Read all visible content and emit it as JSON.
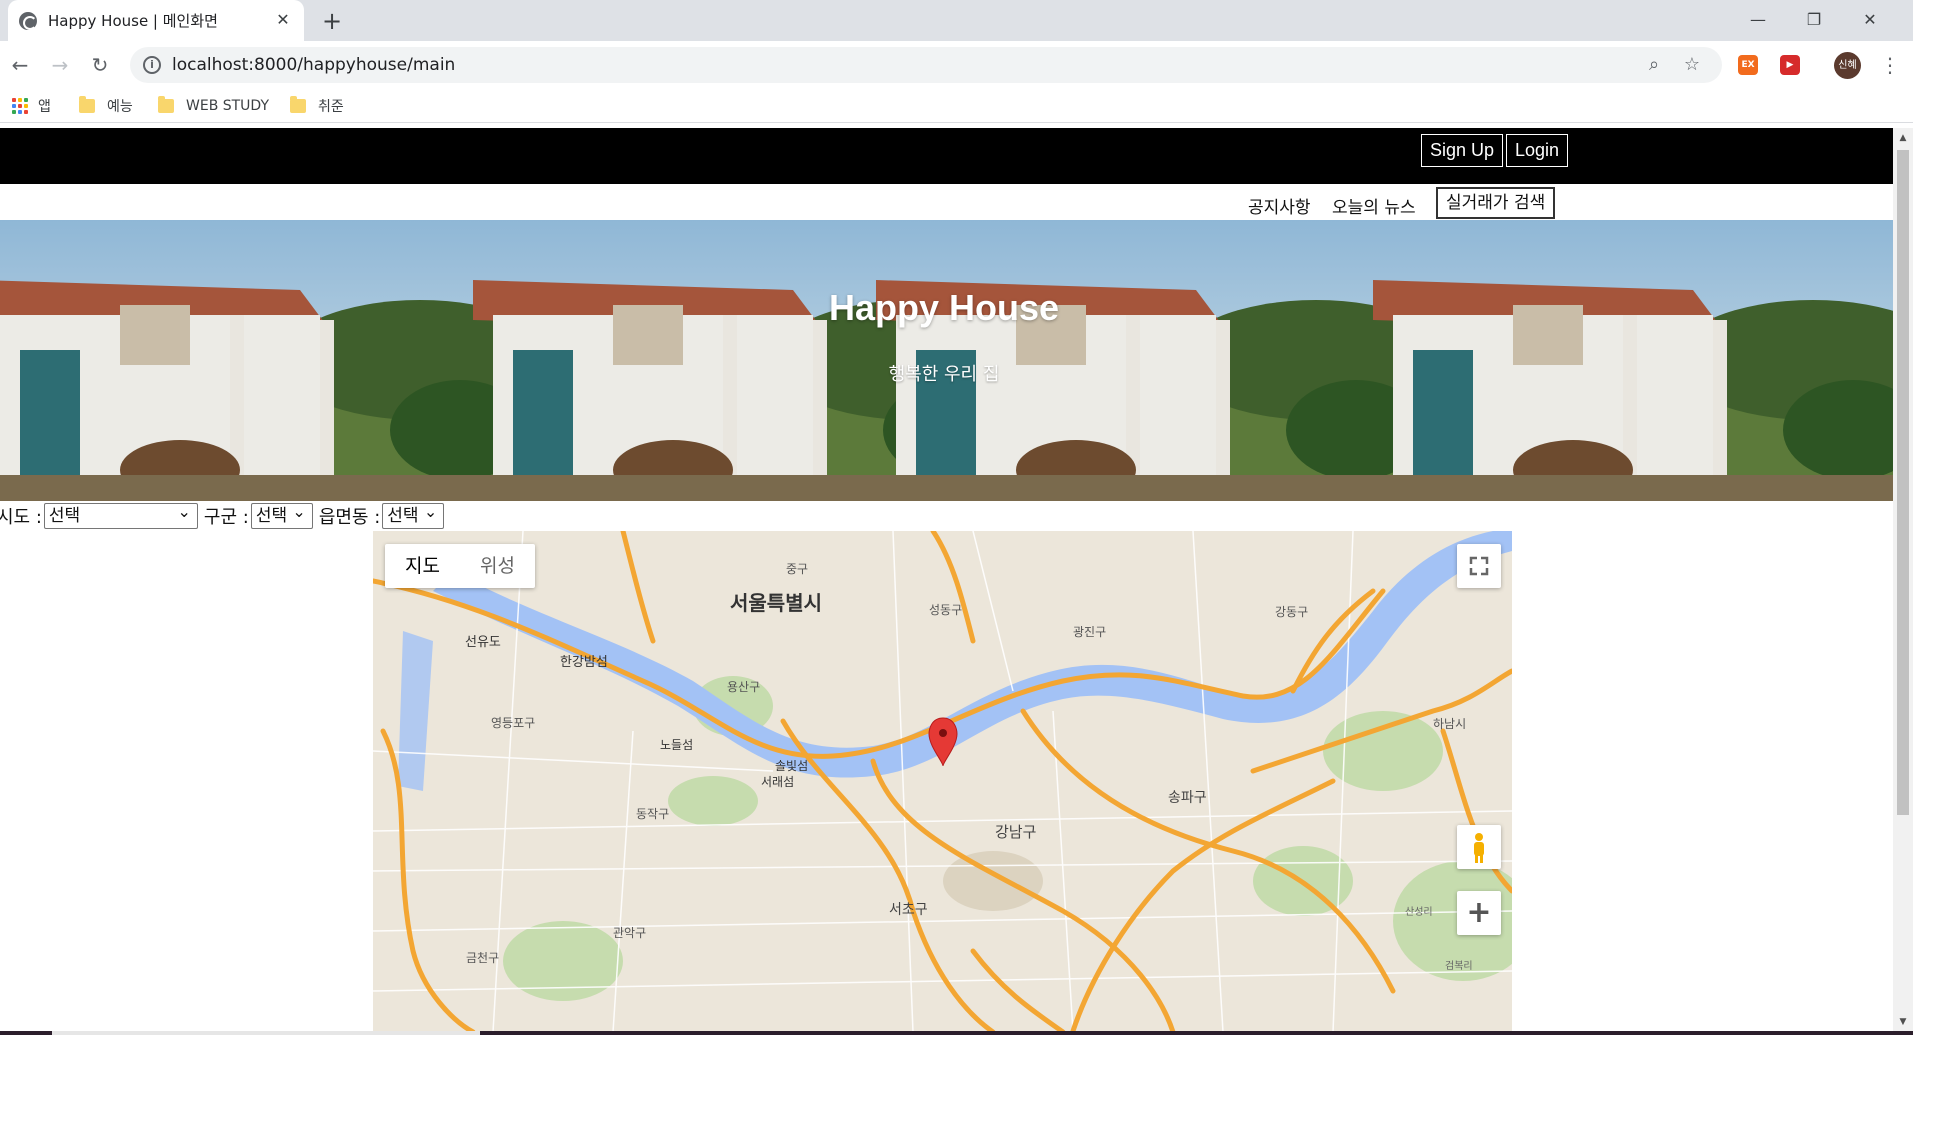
{
  "browser": {
    "tab_title": "Happy House | 메인화면",
    "url": "localhost:8000/happyhouse/main",
    "profile_initials": "신혜",
    "bookmarks": [
      "앱",
      "예능",
      "WEB STUDY",
      "취준"
    ],
    "extensions": [
      "EX",
      "▶"
    ]
  },
  "header": {
    "signup_label": "Sign Up",
    "login_label": "Login"
  },
  "nav": {
    "notice": "공지사항",
    "news": "오늘의 뉴스",
    "search_btn": "실거래가 검색"
  },
  "hero": {
    "title": "Happy House",
    "subtitle": "행복한 우리 집"
  },
  "filters": {
    "sido_label": "시도 :",
    "sido_value": "선택",
    "gugun_label": "구군 :",
    "gugun_value": "선택",
    "dong_label": "읍면동 :",
    "dong_value": "선택"
  },
  "map": {
    "type_map": "지도",
    "type_satellite": "위성",
    "zoom_in": "+",
    "labels": [
      "중구",
      "서울특별시",
      "성동구",
      "광진구",
      "강동구",
      "선유도",
      "한강밤섬",
      "용산구",
      "영등포구",
      "노들섬",
      "솔빛섬",
      "서래섬",
      "동작구",
      "송파구",
      "하남시",
      "강남구",
      "서초구",
      "관악구",
      "금천구",
      "산성리",
      "검복리"
    ]
  },
  "colors": {
    "topbar": "#000000",
    "water": "#a3c2f5",
    "road": "#f3a633",
    "marker": "#e53935"
  }
}
